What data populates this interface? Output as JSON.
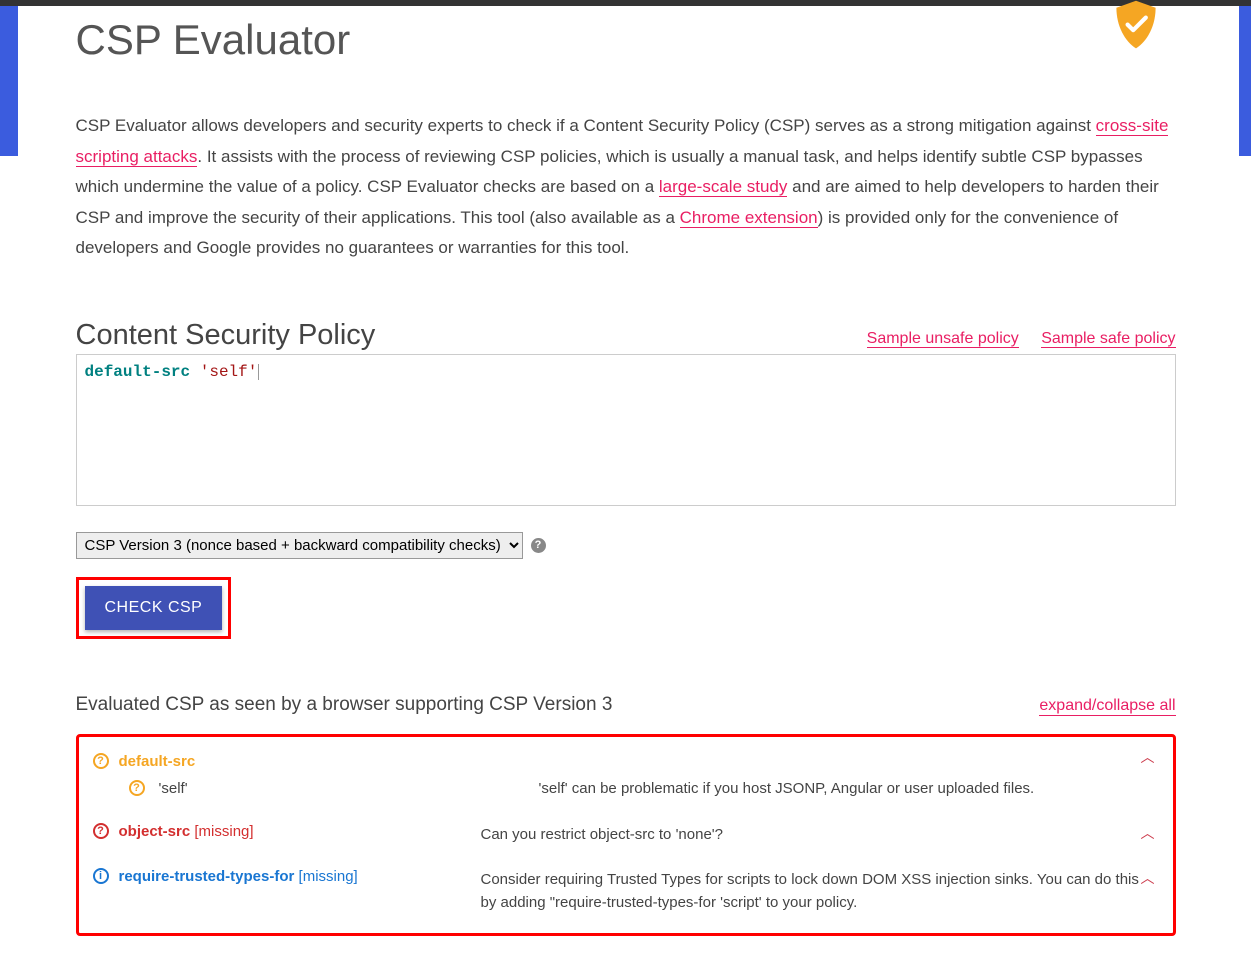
{
  "header": {
    "title": "CSP Evaluator"
  },
  "description": {
    "part1": "CSP Evaluator allows developers and security experts to check if a Content Security Policy (CSP) serves as a strong mitigation against ",
    "link1": "cross-site scripting attacks",
    "part2": ". It assists with the process of reviewing CSP policies, which is usually a manual task, and helps identify subtle CSP bypasses which undermine the value of a policy. CSP Evaluator checks are based on a ",
    "link2": "large-scale study",
    "part3": " and are aimed to help developers to harden their CSP and improve the security of their applications. This tool (also available as a ",
    "link3": "Chrome extension",
    "part4": ") is provided only for the convenience of developers and Google provides no guarantees or warranties for this tool."
  },
  "csp_section": {
    "heading": "Content Security Policy",
    "sample_unsafe": "Sample unsafe policy",
    "sample_safe": "Sample safe policy",
    "input_directive": "default-src",
    "input_value": "'self'",
    "version_select": "CSP Version 3 (nonce based + backward compatibility checks)",
    "check_button": "CHECK CSP"
  },
  "evaluation": {
    "heading": "Evaluated CSP as seen by a browser supporting CSP Version 3",
    "expand_link": "expand/collapse all",
    "results": [
      {
        "severity": "yellow",
        "directive": "default-src",
        "sub_value": "'self'",
        "sub_message": "'self' can be problematic if you host JSONP, Angular or user uploaded files."
      },
      {
        "severity": "red",
        "directive": "object-src",
        "missing": "[missing]",
        "message": "Can you restrict object-src to 'none'?"
      },
      {
        "severity": "blue",
        "directive": "require-trusted-types-for",
        "missing": "[missing]",
        "message": "Consider requiring Trusted Types for scripts to lock down DOM XSS injection sinks. You can do this by adding \"require-trusted-types-for 'script' to your policy."
      }
    ]
  }
}
